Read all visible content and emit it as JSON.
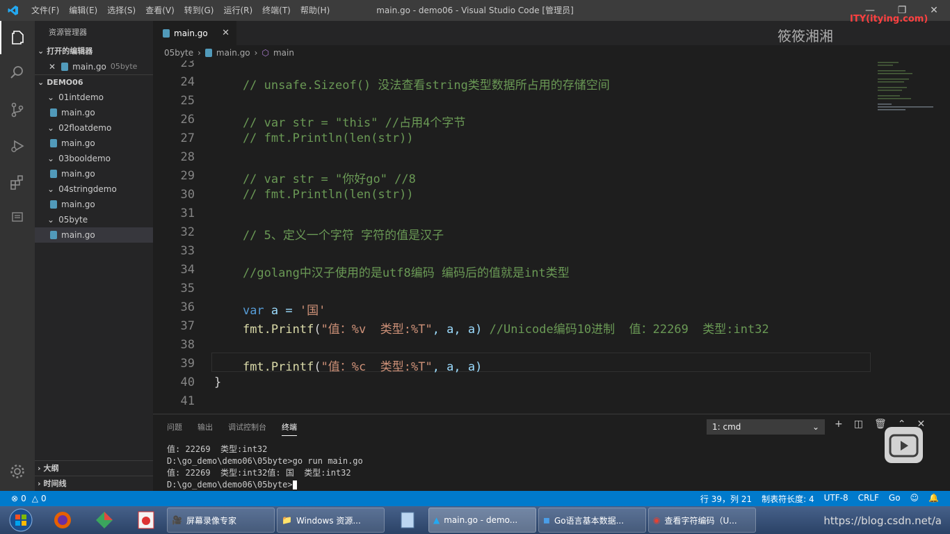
{
  "window": {
    "title": "main.go - demo06 - Visual Studio Code [管理员]"
  },
  "menu": [
    "文件(F)",
    "编辑(E)",
    "选择(S)",
    "查看(V)",
    "转到(G)",
    "运行(R)",
    "终端(T)",
    "帮助(H)"
  ],
  "sidebar": {
    "header": "资源管理器",
    "open_editors_title": "打开的编辑器",
    "open_file": "main.go",
    "open_file_dir": "05byte",
    "workspace": "DEMO06",
    "tree": [
      {
        "label": "01intdemo",
        "type": "folder"
      },
      {
        "label": "main.go",
        "type": "file"
      },
      {
        "label": "02floatdemo",
        "type": "folder"
      },
      {
        "label": "main.go",
        "type": "file"
      },
      {
        "label": "03booldemo",
        "type": "folder"
      },
      {
        "label": "main.go",
        "type": "file"
      },
      {
        "label": "04stringdemo",
        "type": "folder"
      },
      {
        "label": "main.go",
        "type": "file"
      },
      {
        "label": "05byte",
        "type": "folder"
      },
      {
        "label": "main.go",
        "type": "file",
        "selected": true
      }
    ],
    "outline": "大纲",
    "timeline": "时间线"
  },
  "tab": {
    "label": "main.go"
  },
  "breadcrumb": [
    "05byte",
    "main.go",
    "main"
  ],
  "code": [
    {
      "n": "23",
      "t": ""
    },
    {
      "n": "24",
      "t": "    // unsafe.Sizeof() 没法查看string类型数据所占用的存储空间",
      "c": "cmt"
    },
    {
      "n": "25",
      "t": ""
    },
    {
      "n": "26",
      "t": "    // var str = \"this\" //占用4个字节",
      "c": "cmt"
    },
    {
      "n": "27",
      "t": "    // fmt.Println(len(str))",
      "c": "cmt"
    },
    {
      "n": "28",
      "t": ""
    },
    {
      "n": "29",
      "t": "    // var str = \"你好go\" //8",
      "c": "cmt"
    },
    {
      "n": "30",
      "t": "    // fmt.Println(len(str))",
      "c": "cmt"
    },
    {
      "n": "31",
      "t": ""
    },
    {
      "n": "32",
      "t": "    // 5、定义一个字符 字符的值是汉子",
      "c": "cmt"
    },
    {
      "n": "33",
      "t": ""
    },
    {
      "n": "34",
      "t": "    //golang中汉子使用的是utf8编码 编码后的值就是int类型",
      "c": "cmt"
    },
    {
      "n": "35",
      "t": ""
    },
    {
      "n": "36",
      "t": "var a = '国'",
      "c": "var"
    },
    {
      "n": "37",
      "t": "fmt.Printf(\"值：%v  类型:%T\", a, a) //Unicode编码10进制  值：22269  类型:int32",
      "c": "printf"
    },
    {
      "n": "38",
      "t": ""
    },
    {
      "n": "39",
      "t": "fmt.Printf(\"值：%c  类型:%T\", a, a)",
      "c": "printf"
    },
    {
      "n": "40",
      "t": "}"
    },
    {
      "n": "41",
      "t": ""
    }
  ],
  "panel": {
    "tabs": [
      "问题",
      "输出",
      "调试控制台",
      "终端"
    ],
    "terminal_select": "1: cmd",
    "lines": [
      "值: 22269  类型:int32",
      "D:\\go_demo\\demo06\\05byte>go run main.go",
      "值: 22269  类型:int32值: 国  类型:int32",
      "D:\\go_demo\\demo06\\05byte>"
    ]
  },
  "status": {
    "errors": "0",
    "warnings": "0",
    "position": "行 39，列 21",
    "tab_size": "制表符长度: 4",
    "encoding": "UTF-8",
    "eol": "CRLF",
    "language": "Go"
  },
  "taskbar": {
    "tasks": [
      "屏幕录像专家",
      "Windows 资源...",
      "main.go - demo...",
      "Go语言基本数据...",
      "查看字符编码（U..."
    ],
    "url": "https://blog.csdn.net/a"
  },
  "overlay": {
    "watermark": "筱筱湘湘",
    "site": "ITY(itying.com)"
  }
}
